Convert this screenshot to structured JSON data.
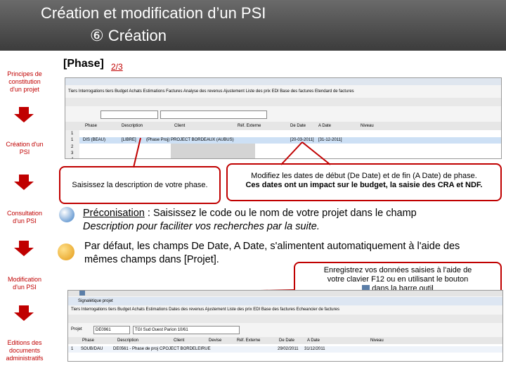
{
  "header": {
    "title": "Création et modification d’un PSI",
    "subtitle": "⑥ Création"
  },
  "sidebar": {
    "items": [
      {
        "label": "Principes de constitution d'un projet"
      },
      {
        "label": "Création d'un PSI"
      },
      {
        "label": "Consultation d'un PSI"
      },
      {
        "label": "Modification d'un PSI"
      },
      {
        "label": "Editions des documents administratifs"
      }
    ]
  },
  "phase": {
    "label": "[Phase]",
    "step": "2/3"
  },
  "screenshot1": {
    "menu": "Tiers  Interrogations tiers  Budget  Achats  Estimations  Factures  Analyse des revenus  Ajustement  Liste des prix  EDI  Base des factures  Etendard de factures",
    "columns": [
      "Phase",
      "Description",
      "Client",
      "Réf. Externe",
      "De Date",
      "A Date",
      "Niveau"
    ],
    "rows": [
      [
        "1"
      ],
      [
        "1",
        "DIS (BEAU)",
        "[LIBRE]",
        "(Phase Proj) PROJECT BORDEAUX (AUBUS)",
        "",
        "[20-03-2011]",
        "[31-12-2011]"
      ],
      [
        "2"
      ],
      [
        "3"
      ],
      [
        "4"
      ]
    ]
  },
  "screenshot2": {
    "title": "Signalétique projet",
    "menu": "Tiers  Interrogations tiers  Budget  Achats  Estimations  Dates des revenus  Ajustement  Liste des prix  EDI  Base des factures  Echeancier de factures",
    "projet_label": "Projet",
    "projet_value": "DE0961",
    "projet_desc": "TGI Sud Ouest Parion 10/61",
    "columns": [
      "Phase",
      "Description",
      "Client",
      "Devise",
      "Réf. Externe",
      "De Date",
      "A Date",
      "Niveau"
    ],
    "row": [
      "1",
      "SOUB/DAU",
      "DE0561 - Phase de proj",
      "CPOJECT BORDELEIRUE",
      "",
      "",
      "29/02/2011",
      "31/12/2011"
    ]
  },
  "callouts": {
    "description": "Saisissez la description de votre phase.",
    "dates_line1": "Modifiez les dates de début (De Date) et de fin (A Date) de phase.",
    "dates_line2": "Ces dates ont un impact sur le budget, la saisie des CRA et NDF.",
    "save_line1": "Enregistrez vos données saisies à l'aide de",
    "save_line2": "votre clavier F12 ou en utilisant le bouton",
    "save_line3": "dans la barre outil"
  },
  "preconisation": {
    "label": "Préconisation",
    "text": " : Saisissez le code ou le nom de votre projet dans le champ",
    "text2": "Description pour faciliter vos recherches par la suite."
  },
  "info": {
    "line1": "Par défaut, les champs De Date, A Date, s'alimentent automatiquement à l'aide des",
    "line2": "mêmes champs dans [Projet]."
  },
  "colors": {
    "accent": "#c00000",
    "header_dark": "#3c3c3c",
    "grid_yellow": "#fff2a8"
  }
}
